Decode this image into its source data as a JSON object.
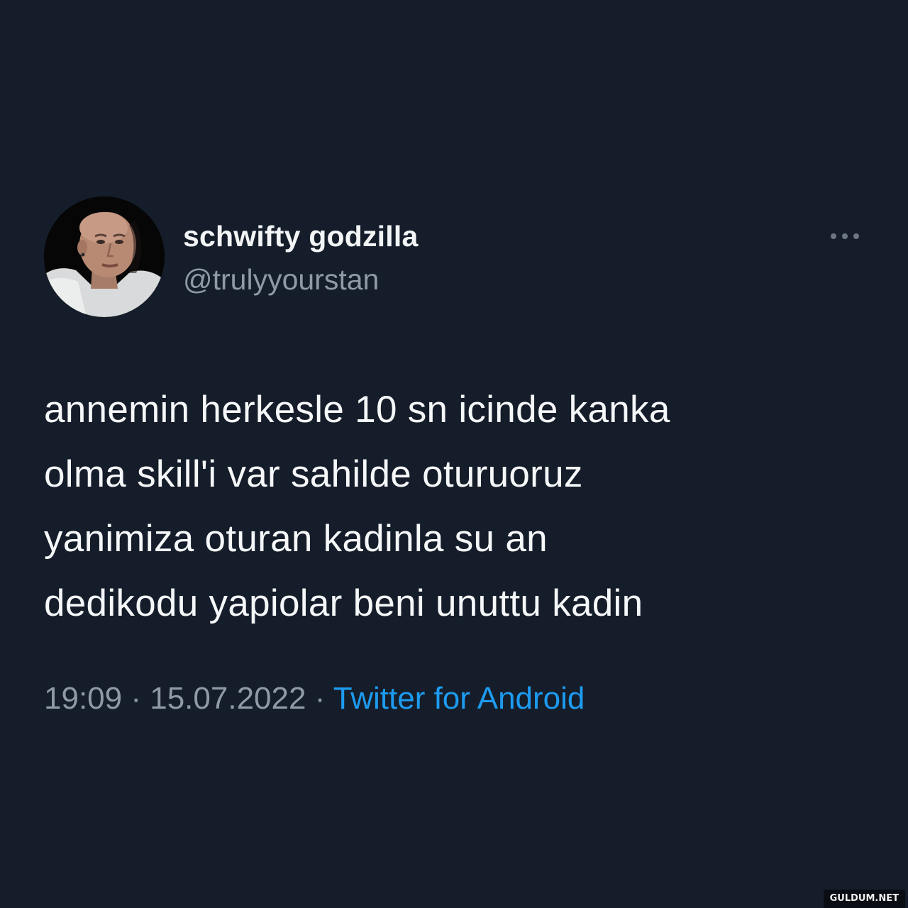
{
  "tweet": {
    "author": {
      "display_name": "schwifty godzilla",
      "handle": "@trulyyourstan",
      "avatar_icon": "profile-photo"
    },
    "more_icon": "more-options-icon",
    "text_lines": [
      "annemin herkesle 10 sn icinde kanka",
      "olma skill'i var sahilde oturuoruz",
      "yanimiza oturan kadinla su an",
      "dedikodu yapiolar beni unuttu kadin"
    ],
    "time": "19:09",
    "separator": "·",
    "date": "15.07.2022",
    "source": "Twitter for Android"
  },
  "watermark": "GULDUM.NET",
  "colors": {
    "background": "#151d2a",
    "text_primary": "#f5f7f9",
    "text_secondary": "#8f9aa6",
    "link": "#1d9bf0"
  }
}
